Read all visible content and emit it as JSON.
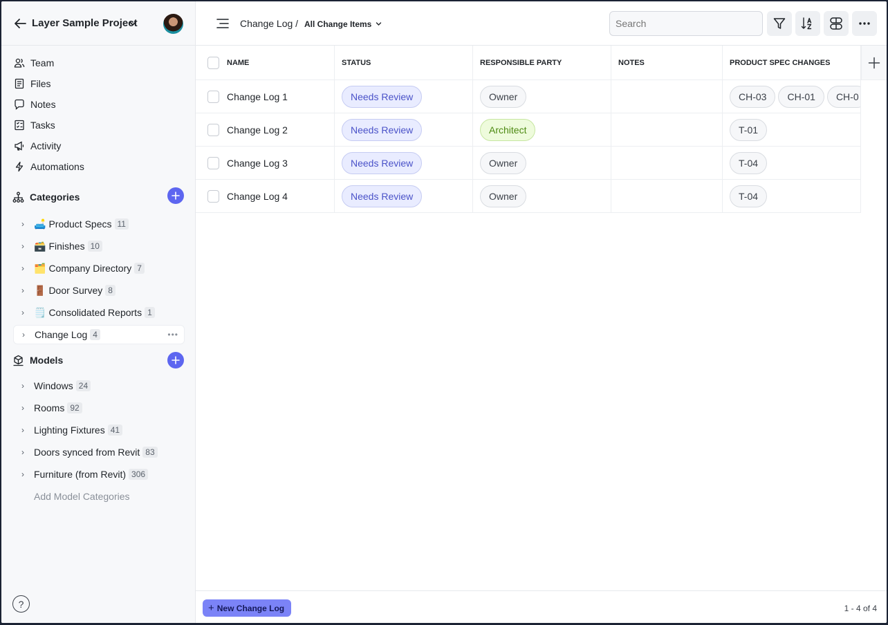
{
  "project": {
    "title": "Layer Sample Project"
  },
  "nav": [
    {
      "label": "Team",
      "icon": "team-icon"
    },
    {
      "label": "Files",
      "icon": "files-icon"
    },
    {
      "label": "Notes",
      "icon": "notes-icon"
    },
    {
      "label": "Tasks",
      "icon": "tasks-icon"
    },
    {
      "label": "Activity",
      "icon": "activity-icon"
    },
    {
      "label": "Automations",
      "icon": "automations-icon"
    }
  ],
  "categories": {
    "title": "Categories",
    "items": [
      {
        "emoji": "🛋️",
        "label": "Product Specs",
        "count": "11"
      },
      {
        "emoji": "🗃️",
        "label": "Finishes",
        "count": "10"
      },
      {
        "emoji": "🗂️",
        "label": "Company Directory",
        "count": "7"
      },
      {
        "emoji": "🚪",
        "label": "Door Survey",
        "count": "8"
      },
      {
        "emoji": "🗒️",
        "label": "Consolidated Reports",
        "count": "1"
      },
      {
        "emoji": "",
        "label": "Change Log",
        "count": "4"
      }
    ]
  },
  "models": {
    "title": "Models",
    "items": [
      {
        "label": "Windows",
        "count": "24"
      },
      {
        "label": "Rooms",
        "count": "92"
      },
      {
        "label": "Lighting Fixtures",
        "count": "41"
      },
      {
        "label": "Doors synced from Revit",
        "count": "83"
      },
      {
        "label": "Furniture (from Revit)",
        "count": "306"
      }
    ],
    "add_label": "Add Model Categories"
  },
  "help": {
    "glyph": "?"
  },
  "breadcrumb": {
    "base": "Change Log /",
    "view": "All Change Items"
  },
  "search": {
    "placeholder": "Search"
  },
  "table": {
    "headers": {
      "name": "NAME",
      "status": "STATUS",
      "party": "RESPONSIBLE PARTY",
      "notes": "NOTES",
      "spec": "PRODUCT SPEC CHANGES"
    },
    "rows": [
      {
        "name": "Change Log 1",
        "status": "Needs Review",
        "party": "Owner",
        "notes": "",
        "specs": [
          "CH-03",
          "CH-01",
          "CH-0"
        ]
      },
      {
        "name": "Change Log 2",
        "status": "Needs Review",
        "party": "Architect",
        "notes": "",
        "specs": [
          "T-01"
        ]
      },
      {
        "name": "Change Log 3",
        "status": "Needs Review",
        "party": "Owner",
        "notes": "",
        "specs": [
          "T-04"
        ]
      },
      {
        "name": "Change Log 4",
        "status": "Needs Review",
        "party": "Owner",
        "notes": "",
        "specs": [
          "T-04"
        ]
      }
    ]
  },
  "footer": {
    "new_label": "New Change Log",
    "new_glyph": "+",
    "pager": "1 - 4 of 4"
  },
  "colors": {
    "accent": "#5d66f0",
    "status_text": "#4a52c8",
    "architect_text": "#4d8a12"
  }
}
